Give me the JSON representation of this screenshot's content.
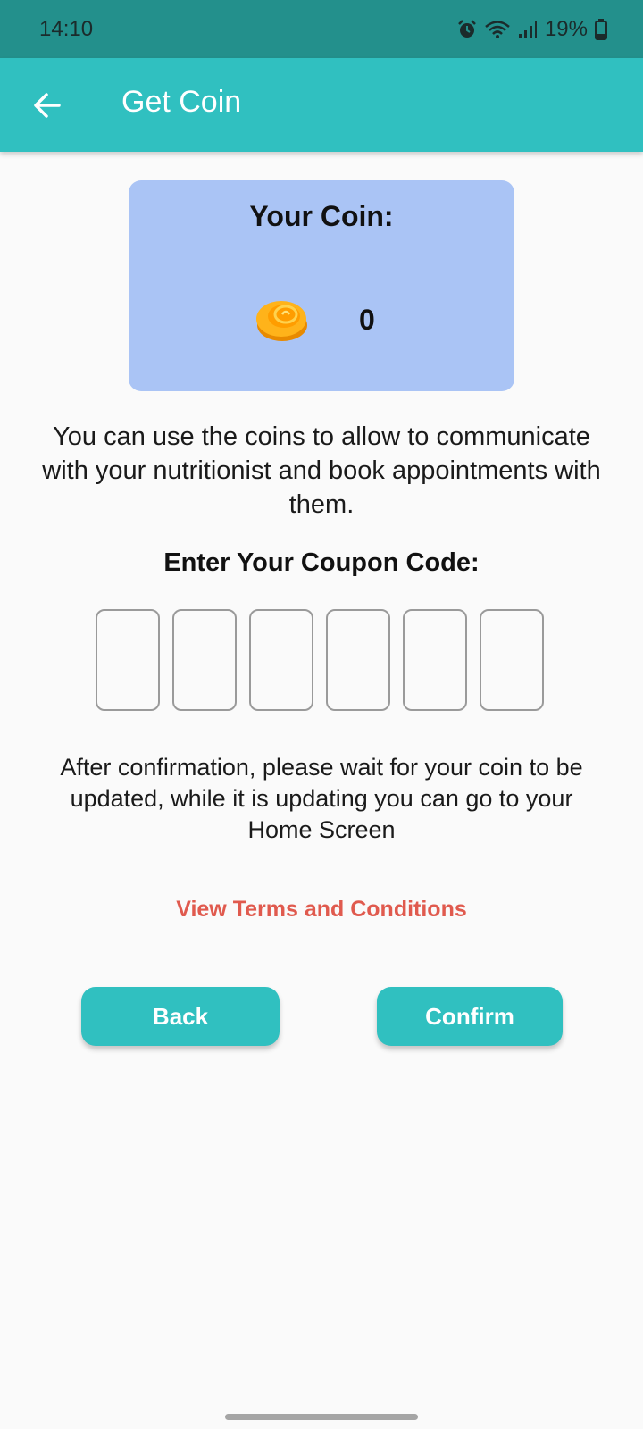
{
  "status_bar": {
    "time": "14:10",
    "battery": "19%",
    "icons": [
      "alarm-icon",
      "wifi-icon",
      "signal-icon",
      "battery-icon"
    ]
  },
  "app_bar": {
    "title": "Get Coin",
    "back_icon": "arrow-left-icon"
  },
  "coin_card": {
    "title": "Your Coin:",
    "value": "0",
    "icon": "coin-icon"
  },
  "info_text": "You can use the coins to allow to communicate with your nutritionist and book appointments with them.",
  "coupon": {
    "label": "Enter Your Coupon Code:",
    "digits": [
      "",
      "",
      "",
      "",
      "",
      ""
    ]
  },
  "after_text": "After confirmation, please wait for your coin to be updated, while it is updating you can go to your Home Screen",
  "terms_link": "View Terms and Conditions",
  "buttons": {
    "back": "Back",
    "confirm": "Confirm"
  },
  "colors": {
    "primary": "#30c0c0",
    "status_bar": "#23908c",
    "coin_card": "#aac4f5",
    "link": "#e05a4e"
  }
}
